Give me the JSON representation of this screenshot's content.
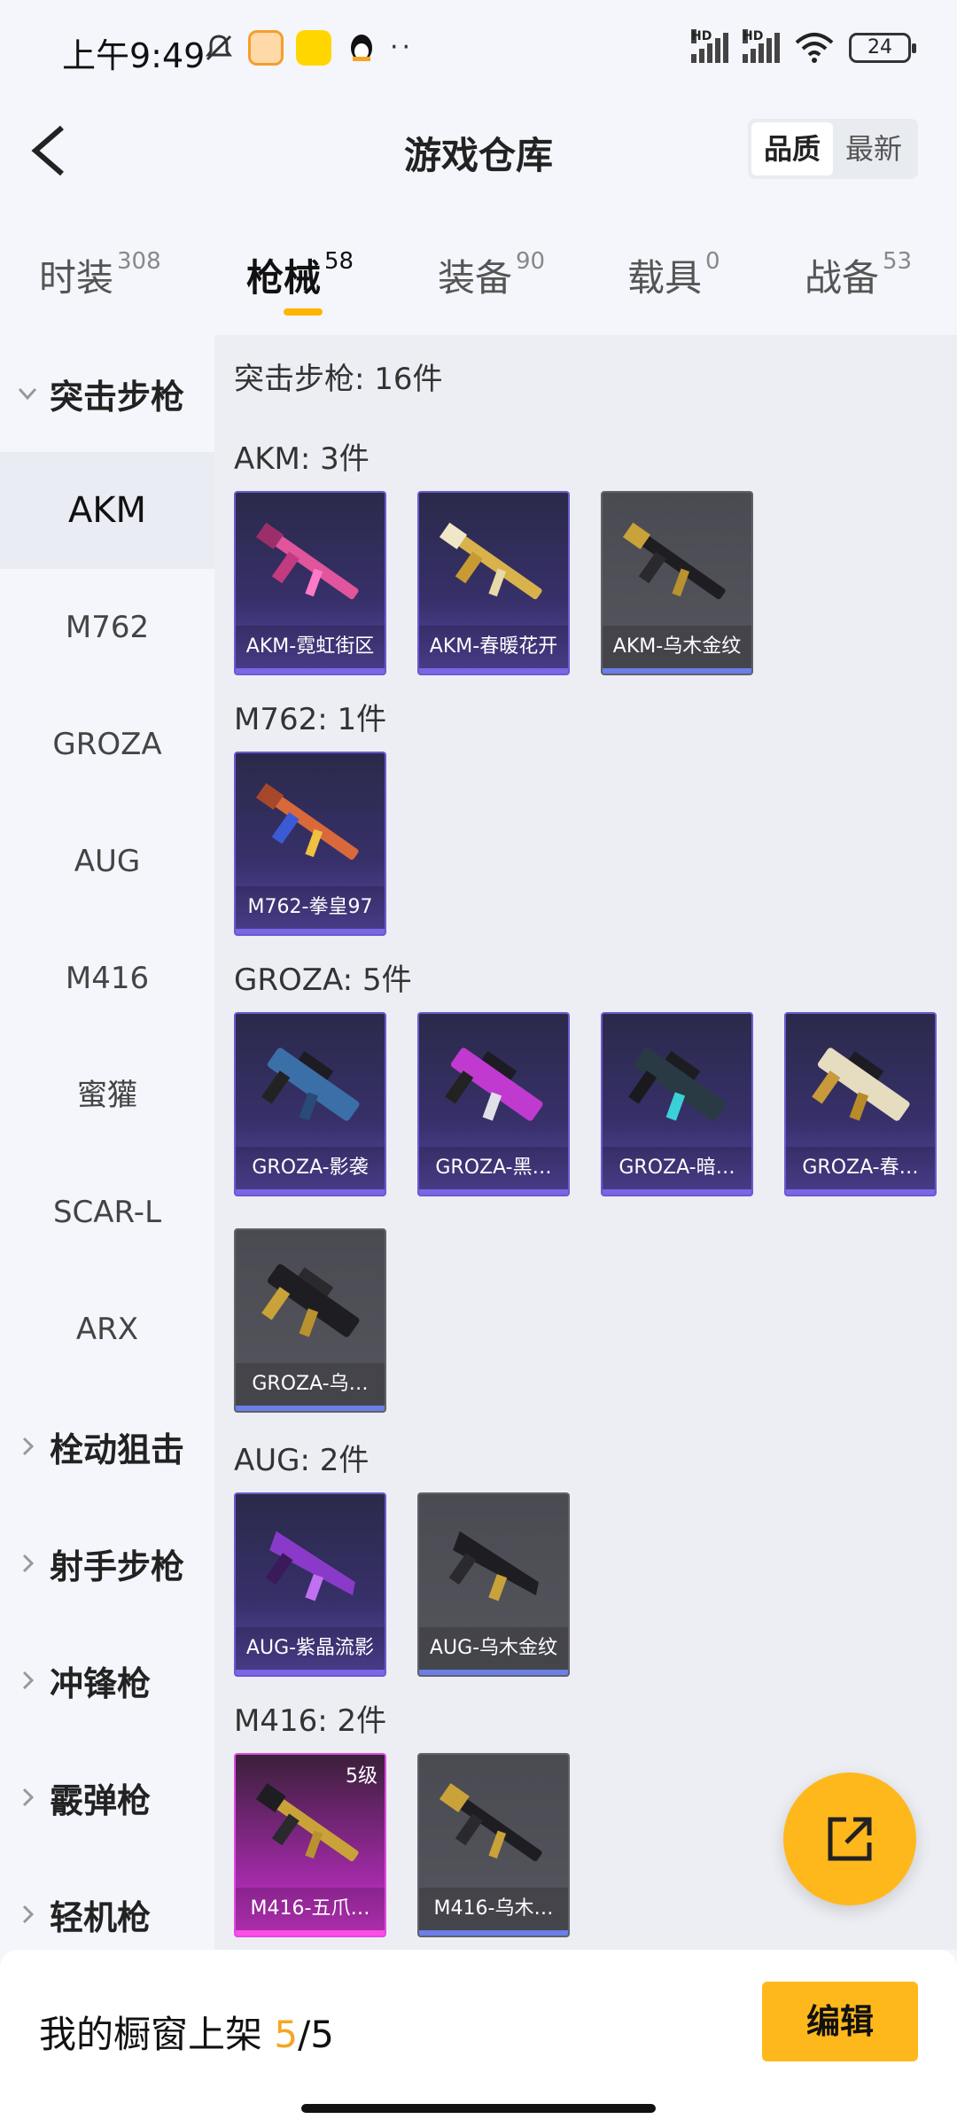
{
  "status": {
    "time": "上午9:49",
    "battery": "24",
    "more": "··",
    "hd1": "HD",
    "hd2": "HD"
  },
  "header": {
    "title": "游戏仓库",
    "sort_options": [
      "品质",
      "最新"
    ],
    "active_sort": "品质"
  },
  "tabs": [
    {
      "label": "时装",
      "count": "308"
    },
    {
      "label": "枪械",
      "count": "58"
    },
    {
      "label": "装备",
      "count": "90"
    },
    {
      "label": "载具",
      "count": "0"
    },
    {
      "label": "战备",
      "count": "53"
    }
  ],
  "sidebar": {
    "category_open": "突击步枪",
    "subitems": [
      "AKM",
      "M762",
      "GROZA",
      "AUG",
      "M416",
      "蜜獾",
      "SCAR-L",
      "ARX"
    ],
    "active_sub": "AKM",
    "categories_closed": [
      "栓动狙击",
      "射手步枪",
      "冲锋枪",
      "霰弹枪",
      "轻机枪"
    ]
  },
  "content": {
    "summary": "突击步枪: 16件",
    "groups": [
      {
        "title": "AKM: 3件",
        "items": [
          "AKM-霓虹街区",
          "AKM-春暖花开",
          "AKM-乌木金纹"
        ]
      },
      {
        "title": "M762: 1件",
        "items": [
          "M762-拳皇97"
        ]
      },
      {
        "title": "GROZA: 5件",
        "items": [
          "GROZA-影袭",
          "GROZA-黑…",
          "GROZA-暗…",
          "GROZA-春…",
          "GROZA-乌…"
        ]
      },
      {
        "title": "AUG: 2件",
        "items": [
          "AUG-紫晶流影",
          "AUG-乌木金纹"
        ]
      },
      {
        "title": "M416: 2件",
        "items": [
          "M416-五爪…",
          "M416-乌木…"
        ],
        "level_badge": "5级"
      }
    ]
  },
  "bottom": {
    "label": "我的橱窗上架",
    "current": "5",
    "total": "/5",
    "edit_button": "编辑"
  },
  "colors": {
    "accent": "#ffb81c",
    "purple_rarity": "#5a4aa8",
    "gray_rarity": "#55565d",
    "pink_rarity": "#d33ad3"
  }
}
